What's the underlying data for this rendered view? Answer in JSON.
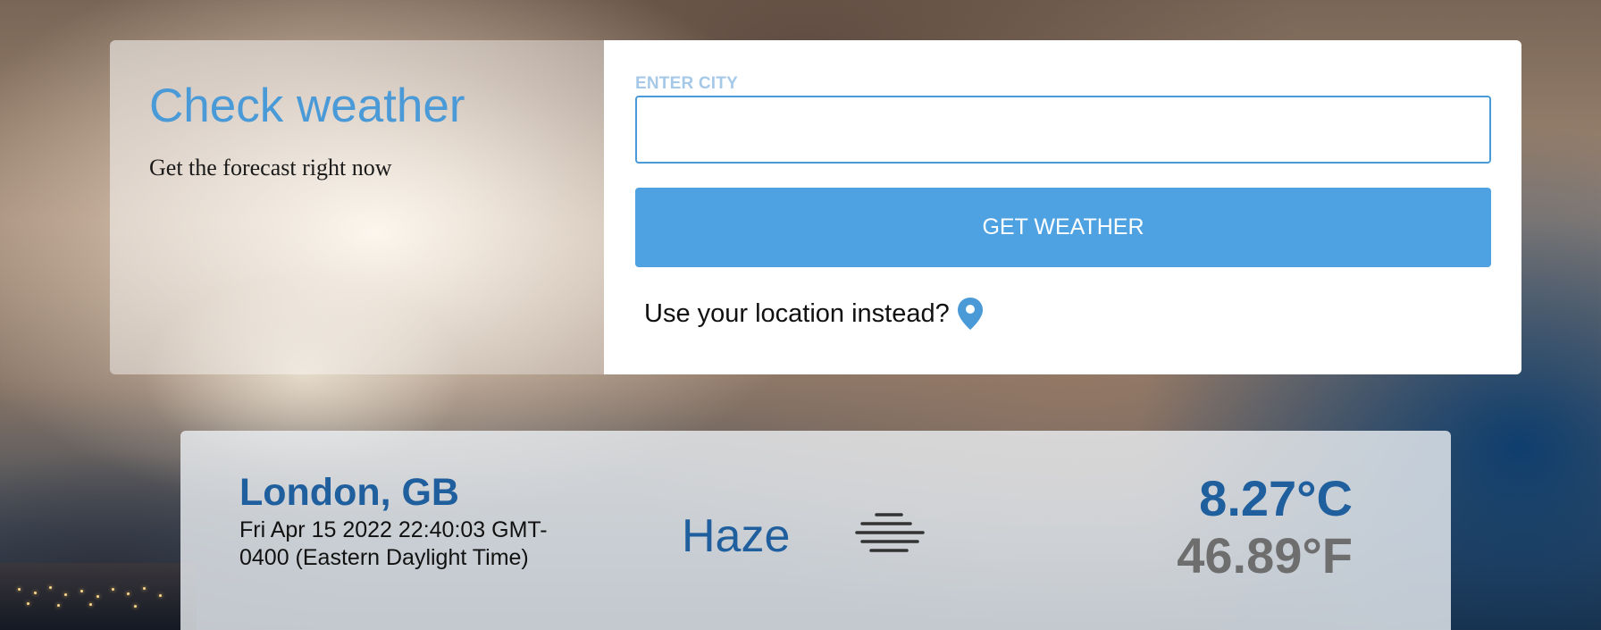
{
  "intro": {
    "title": "Check weather",
    "subtitle": "Get the forecast right now"
  },
  "form": {
    "city_label": "ENTER CITY",
    "city_value": "",
    "city_placeholder": "",
    "submit_label": "GET WEATHER",
    "location_prompt": "Use your location instead?",
    "location_icon": "map-pin-icon"
  },
  "result": {
    "location": "London, GB",
    "datetime": "Fri Apr 15 2022 22:40:03 GMT-0400 (Eastern Daylight Time)",
    "condition": "Haze",
    "condition_icon": "haze-icon",
    "temp_c": "8.27°C",
    "temp_f": "46.89°F"
  },
  "colors": {
    "accent": "#4a9ad8",
    "button": "#4fa2e1",
    "result_blue": "#1f5f9e",
    "result_gray": "#6e6e6e",
    "label_light": "#a6c9e8"
  }
}
